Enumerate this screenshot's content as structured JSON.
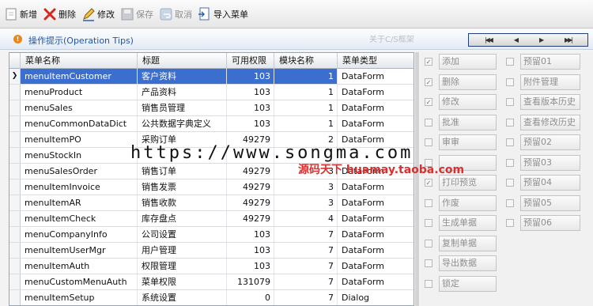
{
  "toolbar": [
    {
      "name": "add",
      "label": "新增",
      "icon": "add-icon",
      "disabled": false
    },
    {
      "name": "delete",
      "label": "删除",
      "icon": "delete-x-icon",
      "disabled": false
    },
    {
      "name": "edit",
      "label": "修改",
      "icon": "pencil-icon",
      "disabled": false
    },
    {
      "name": "save",
      "label": "保存",
      "icon": "save-icon",
      "disabled": true
    },
    {
      "name": "cancel",
      "label": "取消",
      "icon": "undo-icon",
      "disabled": true
    },
    {
      "name": "import-menu",
      "label": "导入菜单",
      "icon": "import-icon",
      "disabled": false
    }
  ],
  "tips": {
    "label": "操作提示(Operation Tips)",
    "about": "关于C/S框架"
  },
  "nav": {
    "buttons": [
      "first",
      "prev",
      "next",
      "last"
    ]
  },
  "grid": {
    "columns": [
      "菜单名称",
      "标题",
      "可用权限",
      "模块名称",
      "菜单类型"
    ],
    "rows": [
      {
        "name": "menuItemCustomer",
        "title": "客户资料",
        "perm": "103",
        "module": "1",
        "type": "DataForm",
        "selected": true
      },
      {
        "name": "menuProduct",
        "title": "产品资料",
        "perm": "103",
        "module": "1",
        "type": "DataForm"
      },
      {
        "name": "menuSales",
        "title": "销售员管理",
        "perm": "103",
        "module": "1",
        "type": "DataForm"
      },
      {
        "name": "menuCommonDataDict",
        "title": "公共数据字典定义",
        "perm": "103",
        "module": "1",
        "type": "DataForm"
      },
      {
        "name": "menuItemPO",
        "title": "采购订单",
        "perm": "49279",
        "module": "2",
        "type": "DataForm"
      },
      {
        "name": "menuStockIn",
        "title": "",
        "perm": "",
        "module": "",
        "type": ""
      },
      {
        "name": "menuSalesOrder",
        "title": "销售订单",
        "perm": "49279",
        "module": "3",
        "type": "DataForm"
      },
      {
        "name": "menuItemInvoice",
        "title": "销售发票",
        "perm": "49279",
        "module": "3",
        "type": "DataForm"
      },
      {
        "name": "menuItemAR",
        "title": "销售收款",
        "perm": "49279",
        "module": "3",
        "type": "DataForm"
      },
      {
        "name": "menuItemCheck",
        "title": "库存盘点",
        "perm": "49279",
        "module": "4",
        "type": "DataForm"
      },
      {
        "name": "menuCompanyInfo",
        "title": "公司设置",
        "perm": "103",
        "module": "7",
        "type": "DataForm"
      },
      {
        "name": "menuItemUserMgr",
        "title": "用户管理",
        "perm": "103",
        "module": "7",
        "type": "DataForm"
      },
      {
        "name": "menuItemAuth",
        "title": "权限管理",
        "perm": "103",
        "module": "7",
        "type": "DataForm"
      },
      {
        "name": "menuCustomMenuAuth",
        "title": "菜单权限",
        "perm": "131079",
        "module": "7",
        "type": "DataForm"
      },
      {
        "name": "menuItemSetup",
        "title": "系统设置",
        "perm": "0",
        "module": "7",
        "type": "Dialog"
      }
    ]
  },
  "permissions": {
    "left": [
      {
        "label": "添加",
        "checked": true
      },
      {
        "label": "删除",
        "checked": true
      },
      {
        "label": "修改",
        "checked": true
      },
      {
        "label": "批准",
        "checked": false
      },
      {
        "label": "审审",
        "checked": false
      },
      {
        "label": "",
        "checked": false
      },
      {
        "label": "打印预览",
        "checked": true
      },
      {
        "label": "作废",
        "checked": false
      },
      {
        "label": "生成单据",
        "checked": false
      },
      {
        "label": "复制单据",
        "checked": false
      },
      {
        "label": "导出数据",
        "checked": false
      },
      {
        "label": "锁定",
        "checked": false
      }
    ],
    "right": [
      {
        "label": "预留01",
        "checked": false
      },
      {
        "label": "附件管理",
        "checked": false
      },
      {
        "label": "查看版本历史",
        "checked": false
      },
      {
        "label": "查看修改历史",
        "checked": false
      },
      {
        "label": "预留02",
        "checked": false
      },
      {
        "label": "预留03",
        "checked": false
      },
      {
        "label": "预留04",
        "checked": false
      },
      {
        "label": "预留05",
        "checked": false
      },
      {
        "label": "预留06",
        "checked": false
      }
    ]
  },
  "watermark": {
    "url": "https://www.songma.com",
    "shop": "源码天下 huamay.taoba.com"
  },
  "colors": {
    "selection": "#3a6fd0",
    "tips_text": "#2156a5",
    "watermark_red": "#dc2f2f"
  }
}
